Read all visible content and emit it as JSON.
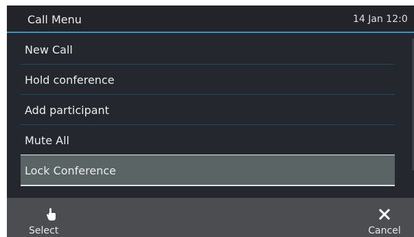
{
  "header": {
    "title": "Call Menu",
    "datetime": "14 Jan 12:0"
  },
  "menu": {
    "items": [
      {
        "label": "New Call",
        "selected": false
      },
      {
        "label": "Hold conference",
        "selected": false
      },
      {
        "label": "Add participant",
        "selected": false
      },
      {
        "label": "Mute All",
        "selected": false
      },
      {
        "label": "Lock Conference",
        "selected": true
      }
    ]
  },
  "softkeys": {
    "select": {
      "label": "Select",
      "icon": "hand-pointer-icon"
    },
    "cancel": {
      "label": "Cancel",
      "icon": "close-icon"
    }
  },
  "colors": {
    "background": "#25272e",
    "accent": "#3a93c4",
    "selected": "#5a6464",
    "softkey_bar": "#4b4d50"
  }
}
